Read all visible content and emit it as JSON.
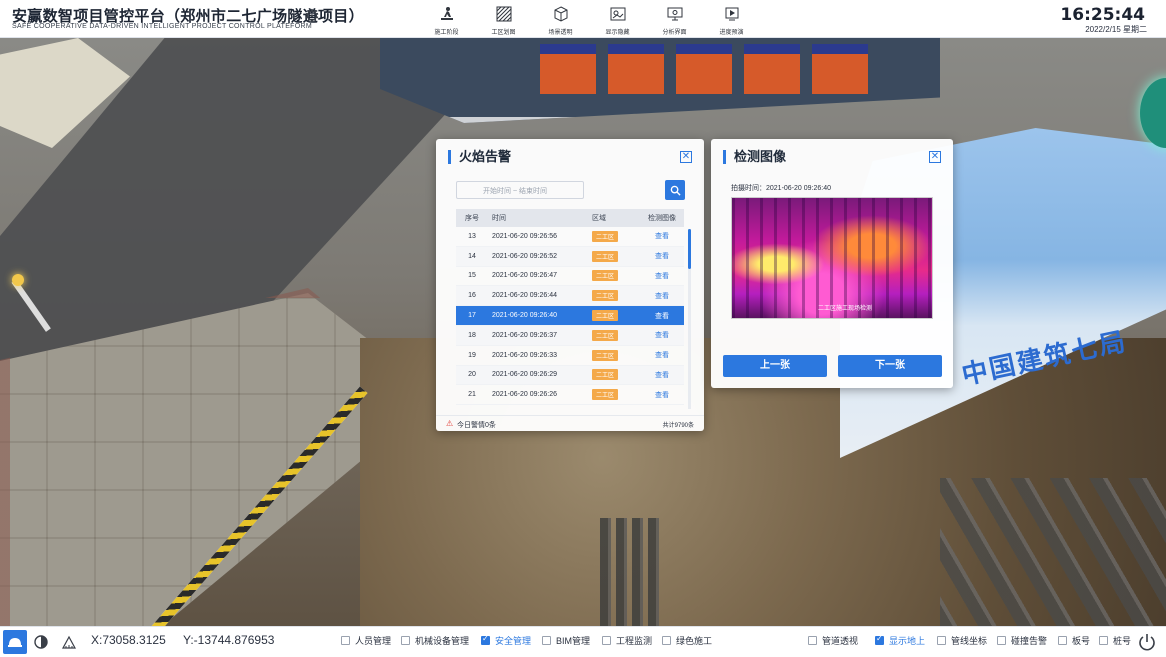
{
  "header": {
    "title": "安赢数智项目管控平台（郑州市二七广场隧道项目）",
    "subtitle": "SAFE COOPERATIVE DATA-DRIVEN INTELLIGENT PROJECT CONTROL PLATEFORM",
    "clock": "16:25:44",
    "date": "2022/2/15 星期二",
    "nav": [
      {
        "label": "施工阶段",
        "icon": "worker-icon"
      },
      {
        "label": "工区划图",
        "icon": "hatch-icon"
      },
      {
        "label": "场景透明",
        "icon": "cube-icon"
      },
      {
        "label": "显示隐藏",
        "icon": "layers-icon"
      },
      {
        "label": "分析界面",
        "icon": "monitor-icon"
      },
      {
        "label": "进度预演",
        "icon": "play-icon"
      }
    ]
  },
  "fire_panel": {
    "title": "火焰告警",
    "search_placeholder": "开始时间 ~ 结束时间",
    "columns": [
      "序号",
      "时间",
      "区域",
      "检测图像"
    ],
    "rows": [
      {
        "no": "13",
        "time": "2021-06-20 09:26:56",
        "area": "二工区",
        "action": "查看"
      },
      {
        "no": "14",
        "time": "2021-06-20 09:26:52",
        "area": "二工区",
        "action": "查看"
      },
      {
        "no": "15",
        "time": "2021-06-20 09:26:47",
        "area": "二工区",
        "action": "查看"
      },
      {
        "no": "16",
        "time": "2021-06-20 09:26:44",
        "area": "二工区",
        "action": "查看"
      },
      {
        "no": "17",
        "time": "2021-06-20 09:26:40",
        "area": "二工区",
        "action": "查看",
        "selected": true
      },
      {
        "no": "18",
        "time": "2021-06-20 09:26:37",
        "area": "二工区",
        "action": "查看"
      },
      {
        "no": "19",
        "time": "2021-06-20 09:26:33",
        "area": "二工区",
        "action": "查看"
      },
      {
        "no": "20",
        "time": "2021-06-20 09:26:29",
        "area": "二工区",
        "action": "查看"
      },
      {
        "no": "21",
        "time": "2021-06-20 09:26:26",
        "area": "二工区",
        "action": "查看"
      }
    ],
    "today_alarm": "今日警情0条",
    "total": "共计9790条"
  },
  "image_panel": {
    "title": "检测图像",
    "shot_time": "拍摄时间：2021-06-20 09:26:40",
    "image_caption": "二工区施工现场检测",
    "prev_label": "上一张",
    "next_label": "下一张"
  },
  "scene": {
    "tunnel_text": "中国建筑七局"
  },
  "bottom": {
    "x_coord": "X:73058.3125",
    "y_coord": "Y:-13744.876953",
    "left_checks": [
      {
        "label": "人员管理",
        "checked": false
      },
      {
        "label": "机械设备管理",
        "checked": false
      },
      {
        "label": "安全管理",
        "checked": true
      },
      {
        "label": "BIM管理",
        "checked": false
      },
      {
        "label": "工程监测",
        "checked": false
      },
      {
        "label": "绿色施工",
        "checked": false
      }
    ],
    "right_checks": [
      {
        "label": "管道透视",
        "checked": false
      },
      {
        "label": "显示地上",
        "checked": true
      },
      {
        "label": "管线坐标",
        "checked": false
      },
      {
        "label": "碰撞告警",
        "checked": false
      },
      {
        "label": "板号",
        "checked": false
      },
      {
        "label": "桩号",
        "checked": false
      }
    ]
  },
  "colors": {
    "accent": "#2c78df",
    "badge": "#f4a94a",
    "alarm": "#e2403a"
  }
}
